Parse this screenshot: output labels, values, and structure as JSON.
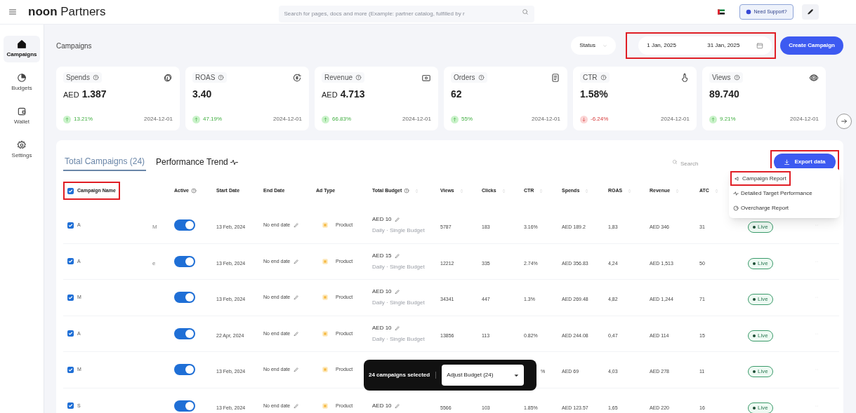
{
  "header": {
    "brand_bold": "noon",
    "brand": "Partners",
    "search_placeholder": "Search for pages, docs and more (Example: partner catalog, fulfilled by r",
    "support": "Need Support?"
  },
  "sidebar": [
    {
      "label": "Campaigns",
      "kind": "home",
      "selected": true
    },
    {
      "label": "Budgets",
      "kind": "pie",
      "selected": false
    },
    {
      "label": "Wallet",
      "kind": "wallet",
      "selected": false
    },
    {
      "label": "Settings",
      "kind": "gear",
      "selected": false
    }
  ],
  "page_title": "Campaigns",
  "status_filter": "Status",
  "date_range": {
    "start": "1 Jan, 2025",
    "end": "31 Jan, 2025",
    "highlighted": true
  },
  "create_button": "Create Campaign",
  "metrics": [
    {
      "label": "Spends",
      "prefix": "AED",
      "value": "1.387",
      "change": "13.21%",
      "declining": false,
      "date": "2024-12-01",
      "kind": "coin"
    },
    {
      "label": "ROAS",
      "value": "3.40",
      "change": "47.19%",
      "declining": false,
      "date": "2024-12-01",
      "kind": "refresh"
    },
    {
      "label": "Revenue",
      "prefix": "AED",
      "value": "4.713",
      "change": "66.83%",
      "declining": false,
      "date": "2024-12-01",
      "kind": "cash"
    },
    {
      "label": "Orders",
      "value": "62",
      "change": "55%",
      "declining": false,
      "date": "2024-12-01",
      "kind": "doc"
    },
    {
      "label": "CTR",
      "value": "1.58%",
      "change": "-6.24%",
      "declining": true,
      "date": "2024-12-01",
      "kind": "hand"
    },
    {
      "label": "Views",
      "value": "89.740",
      "change": "9.21%",
      "declining": false,
      "date": "2024-12-01",
      "kind": "eye"
    }
  ],
  "tabs": [
    {
      "label": "Total Campaigns (24)",
      "selected": true
    },
    {
      "label": "Performance Trend",
      "selected": false
    }
  ],
  "table_search": {
    "placeholder": "Search"
  },
  "export": {
    "label": "Export data",
    "highlighted": true
  },
  "export_menu": [
    {
      "label": "Campaign Report",
      "kind": "megaphone",
      "highlighted": true
    },
    {
      "label": "Detailed Target Performance",
      "kind": "pulse",
      "highlighted": false
    },
    {
      "label": "Overcharge Report",
      "kind": "gauge",
      "highlighted": false
    }
  ],
  "table": {
    "select_all": {
      "checked": true,
      "highlighted": true
    },
    "columns": [
      {
        "label": "Campaign Name",
        "help": false,
        "sortable": false
      },
      {
        "label": "Active",
        "help": true,
        "sortable": false
      },
      {
        "label": "Start Date",
        "help": false,
        "sortable": false
      },
      {
        "label": "End Date",
        "help": false,
        "sortable": false
      },
      {
        "label": "Ad Type",
        "help": false,
        "sortable": false
      },
      {
        "label": "Total Budget",
        "help": true,
        "sortable": true
      },
      {
        "label": "Views",
        "help": false,
        "sortable": true
      },
      {
        "label": "Clicks",
        "help": false,
        "sortable": true
      },
      {
        "label": "CTR",
        "help": false,
        "sortable": true
      },
      {
        "label": "Spends",
        "help": false,
        "sortable": true
      },
      {
        "label": "ROAS",
        "help": false,
        "sortable": true
      },
      {
        "label": "Revenue",
        "help": false,
        "sortable": true
      },
      {
        "label": "ATC",
        "help": false,
        "sortable": true
      }
    ],
    "rows": [
      {
        "checked": true,
        "name": "A",
        "column_2": "M",
        "active": true,
        "start_date": "13 Feb, 2024",
        "end_date": "No end date",
        "ad_type": "Product",
        "budget": "AED 10",
        "budget_note": "Daily · Single Budget",
        "views": "5787",
        "clicks": "183",
        "ctr": "3.16%",
        "spends": "AED 189.2",
        "roas": "1,83",
        "revenue": "AED 346",
        "atc": "31",
        "status": "Live"
      },
      {
        "checked": true,
        "name": "A",
        "column_2": "e",
        "active": true,
        "start_date": "13 Feb, 2024",
        "end_date": "No end date",
        "ad_type": "Product",
        "budget": "AED 15",
        "budget_note": "Daily · Single Budget",
        "views": "12212",
        "clicks": "335",
        "ctr": "2.74%",
        "spends": "AED 356.83",
        "roas": "4,24",
        "revenue": "AED 1,513",
        "atc": "50",
        "status": "Live"
      },
      {
        "checked": true,
        "name": "M",
        "active": true,
        "start_date": "13 Feb, 2024",
        "end_date": "No end date",
        "ad_type": "Product",
        "budget": "AED 10",
        "budget_note": "Daily · Single Budget",
        "views": "34341",
        "clicks": "447",
        "ctr": "1.3%",
        "spends": "AED 269.48",
        "roas": "4,82",
        "revenue": "AED 1,244",
        "atc": "71",
        "status": "Live"
      },
      {
        "checked": true,
        "name": "A",
        "active": true,
        "start_date": "22 Apr, 2024",
        "end_date": "No end date",
        "ad_type": "Product",
        "budget": "AED 10",
        "budget_note": "Daily · Single Budget",
        "views": "13856",
        "clicks": "113",
        "ctr": "0.82%",
        "spends": "AED 244.08",
        "roas": "0,47",
        "revenue": "AED 114",
        "atc": "15",
        "status": "Live"
      },
      {
        "checked": true,
        "name": "M",
        "active": true,
        "start_date": "13 Feb, 2024",
        "end_date": "No end date",
        "ad_type": "Product",
        "ctr": "%",
        "spends": "AED 69",
        "roas": "4,03",
        "revenue": "AED 278",
        "atc": "11",
        "status": "Live"
      },
      {
        "checked": true,
        "name": "S",
        "active": true,
        "start_date": "13 Feb, 2024",
        "end_date": "No end date",
        "ad_type": "Product",
        "budget": "AED 10",
        "views": "5566",
        "clicks": "103",
        "ctr": "1.85%",
        "spends": "AED 123.57",
        "roas": "1,65",
        "revenue": "AED 220",
        "atc": "16",
        "status": "Live"
      }
    ]
  },
  "selection_bar": {
    "text": "24 campaigns selected",
    "action": "Adjust Budget (24)"
  }
}
